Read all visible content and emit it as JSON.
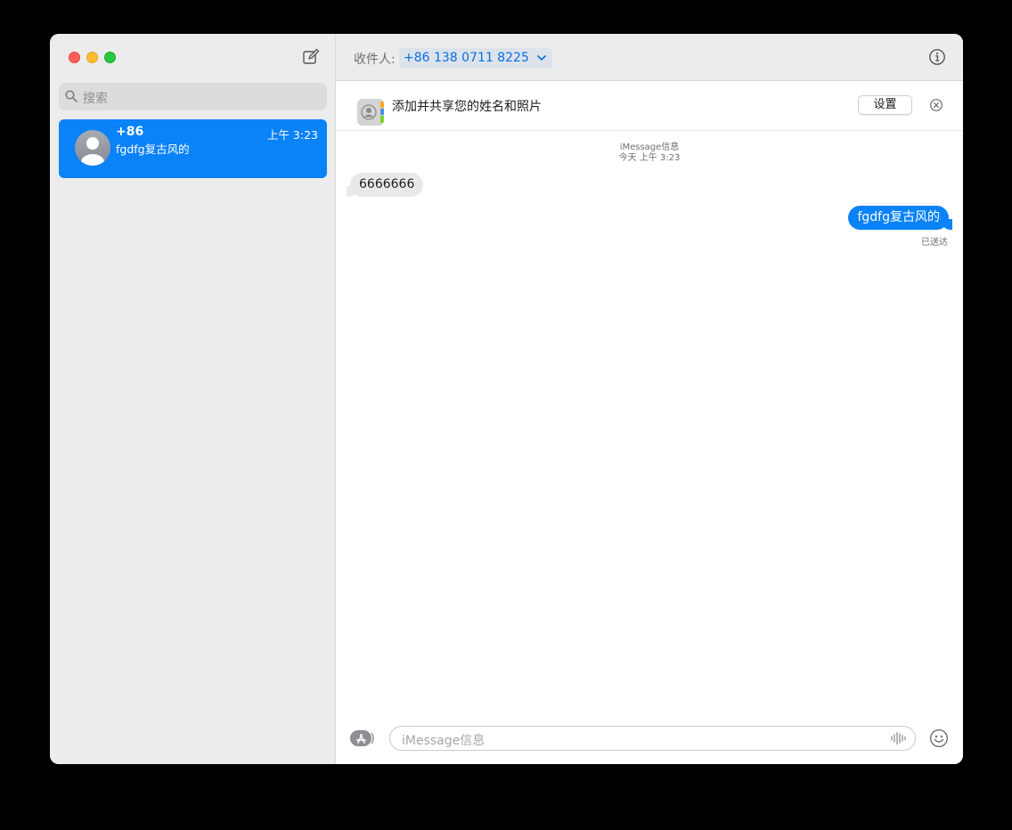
{
  "sidebar": {
    "search_placeholder": "搜索",
    "conversations": [
      {
        "name": "+86",
        "preview": "fgdfg复古风的",
        "time": "上午 3:23"
      }
    ]
  },
  "header": {
    "to_label": "收件人:",
    "recipient": "+86 138 0711 8225"
  },
  "banner": {
    "text": "添加并共享您的姓名和照片",
    "button": "设置"
  },
  "thread": {
    "service": "iMessage信息",
    "timestamp": "今天 上午 3:23",
    "messages": [
      {
        "direction": "incoming",
        "text": "6666666"
      },
      {
        "direction": "outgoing",
        "text": "fgdfg复古风的"
      }
    ],
    "status": "已送达"
  },
  "composer": {
    "placeholder": "iMessage信息"
  },
  "colors": {
    "accent": "#0a82f8",
    "incoming_bubble": "#e9e9eb",
    "sidebar_bg": "#ececec"
  },
  "icons": [
    "compose-icon",
    "search-icon",
    "chevron-down-icon",
    "info-icon",
    "contacts-icon",
    "close-icon",
    "app-store-icon",
    "audio-wave-icon",
    "emoji-icon"
  ]
}
